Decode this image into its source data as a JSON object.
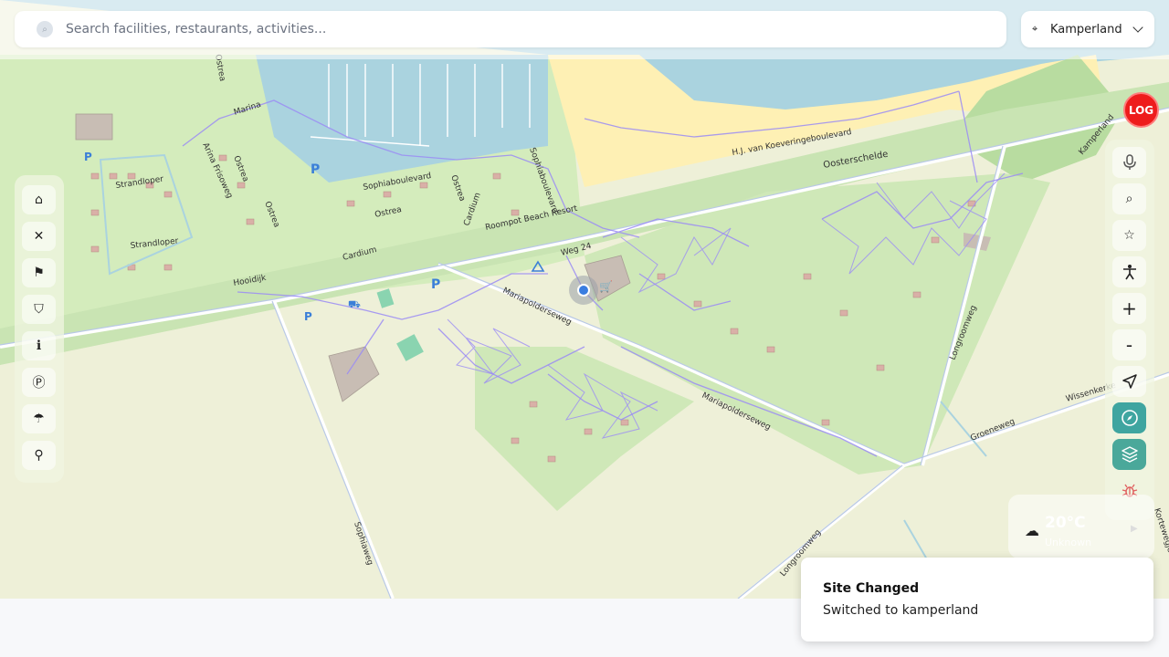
{
  "search": {
    "placeholder": "Search facilities, restaurants, activities...",
    "icon": "search-icon"
  },
  "site_selector": {
    "value": "Kamperland",
    "icon": "location-pin-icon"
  },
  "map": {
    "street_labels": [
      "Strandloper",
      "Strandloper",
      "Marina",
      "Arina Frisoweg",
      "Ostrea",
      "Ostrea",
      "Ostrea",
      "Ostrea",
      "Ostrea",
      "Sophiaboulevard",
      "Sophiaboulevard",
      "Cardium",
      "Cardium",
      "Roompot Beach Resort",
      "Hooidijk",
      "Weg 24",
      "Mariapolderseweg",
      "Mariapolderseweg",
      "H.J. van Koeveringeboulevard",
      "Oosterschelde",
      "Kamperland",
      "Longroomweg",
      "Longroomweg",
      "Wissenkerke",
      "Groeneweg",
      "Sophiaweg",
      "Kortewegje"
    ]
  },
  "left_toolbar": {
    "icons": [
      "home-icon",
      "restaurant-icon",
      "activity-icon",
      "shop-icon",
      "info-icon",
      "parking-icon",
      "beach-icon",
      "toilet-icon"
    ]
  },
  "log_button": {
    "label": "LOG",
    "color": "#ee1c1c"
  },
  "right_toolbar": {
    "icons": [
      "microphone-icon",
      "search-poi-icon",
      "bookmark-icon",
      "accessibility-icon",
      "zoom-in-icon",
      "zoom-out-icon",
      "navigate-icon",
      "compass-icon",
      "layers-icon",
      "bug-icon"
    ],
    "zoom_in_label": "+",
    "zoom_out_label": "-"
  },
  "weather": {
    "temperature": "20°C",
    "condition": "Unknown",
    "icon": "cloud-icon"
  },
  "toast": {
    "title": "Site Changed",
    "message": "Switched to kamperland"
  },
  "colors": {
    "trail": "#9b8cf5",
    "water": "#aad3df",
    "sand": "#fef0b4",
    "grass": "#d2ecbb",
    "accent_teal": "#3fa5a0",
    "log_red": "#ee1c1c"
  }
}
